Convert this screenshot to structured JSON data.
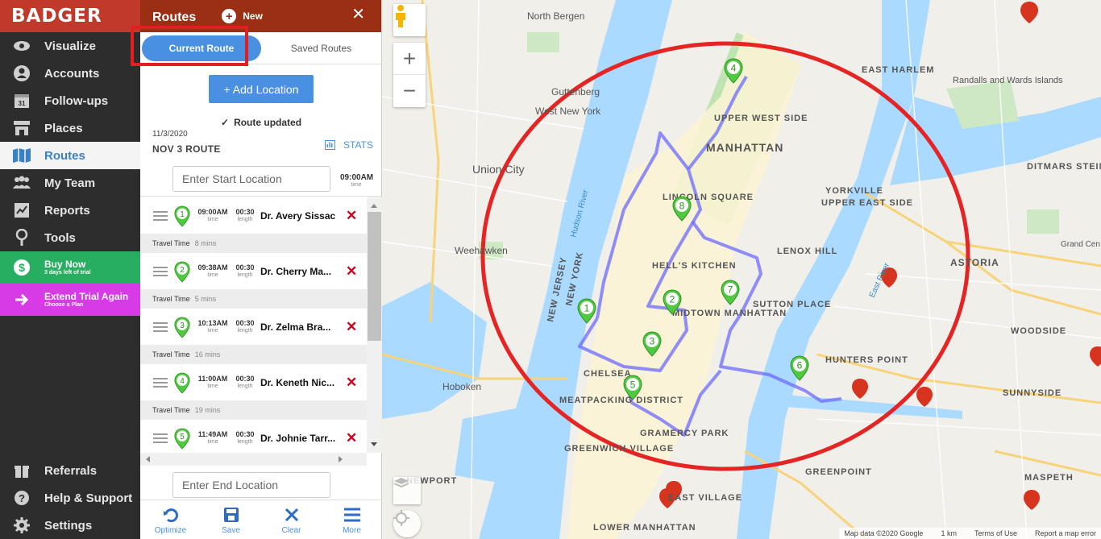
{
  "app": {
    "logo": "BADGER"
  },
  "nav": {
    "items": [
      {
        "key": "visualize",
        "label": "Visualize",
        "icon": "eye-icon"
      },
      {
        "key": "accounts",
        "label": "Accounts",
        "icon": "user-icon"
      },
      {
        "key": "followups",
        "label": "Follow-ups",
        "icon": "calendar-icon"
      },
      {
        "key": "places",
        "label": "Places",
        "icon": "store-icon"
      },
      {
        "key": "routes",
        "label": "Routes",
        "icon": "map-icon",
        "active": true
      },
      {
        "key": "myteam",
        "label": "My Team",
        "icon": "team-icon"
      },
      {
        "key": "reports",
        "label": "Reports",
        "icon": "report-icon"
      },
      {
        "key": "tools",
        "label": "Tools",
        "icon": "tools-icon"
      }
    ],
    "buy_now": {
      "label": "Buy Now",
      "sub": "3 days left of trial"
    },
    "extend": {
      "label": "Extend Trial Again",
      "sub": "Choose a Plan"
    },
    "bottom": [
      {
        "label": "Referrals",
        "icon": "gift-icon"
      },
      {
        "label": "Help & Support",
        "icon": "help-icon"
      },
      {
        "label": "Settings",
        "icon": "gear-icon"
      }
    ]
  },
  "panel": {
    "title": "Routes",
    "new_label": "New",
    "close": "✕",
    "tabs": {
      "current": "Current Route",
      "saved": "Saved Routes"
    },
    "add_location": "+ Add Location",
    "status": "Route updated",
    "status_check": "✓",
    "date": "11/3/2020",
    "route_name": "NOV 3 ROUTE",
    "stats": "STATS",
    "start_placeholder": "Enter Start Location",
    "start_time": "09:00AM",
    "time_label": "time",
    "length_label": "length",
    "travel_label": "Travel Time",
    "stops": [
      {
        "num": "1",
        "time": "09:00AM",
        "length": "00:30",
        "name": "Dr. Avery Sissac",
        "travel": "8 mins"
      },
      {
        "num": "2",
        "time": "09:38AM",
        "length": "00:30",
        "name": "Dr. Cherry Ma...",
        "travel": "5 mins"
      },
      {
        "num": "3",
        "time": "10:13AM",
        "length": "00:30",
        "name": "Dr. Zelma Bra...",
        "travel": "16 mins"
      },
      {
        "num": "4",
        "time": "11:00AM",
        "length": "00:30",
        "name": "Dr. Keneth Nic...",
        "travel": "19 mins"
      },
      {
        "num": "5",
        "time": "11:49AM",
        "length": "00:30",
        "name": "Dr. Johnie Tarr..."
      }
    ],
    "end_placeholder": "Enter End Location",
    "toolbar": [
      {
        "label": "Optimize",
        "icon": "optimize-icon"
      },
      {
        "label": "Save",
        "icon": "save-icon"
      },
      {
        "label": "Clear",
        "icon": "clear-icon"
      },
      {
        "label": "More",
        "icon": "menu-icon"
      }
    ]
  },
  "map": {
    "labels": [
      "North Bergen",
      "Guttenberg",
      "West New York",
      "Union City",
      "Weehawken",
      "Hoboken",
      "MANHATTAN",
      "UPPER WEST SIDE",
      "LINCOLN SQUARE",
      "HELL'S KITCHEN",
      "MIDTOWN MANHATTAN",
      "CHELSEA",
      "MEATPACKING DISTRICT",
      "GRAMERCY PARK",
      "GREENWICH VILLAGE",
      "EAST VILLAGE",
      "LOWER MANHATTAN",
      "NEWPORT",
      "YORKVILLE",
      "UPPER EAST SIDE",
      "LENOX HILL",
      "SUTTON PLACE",
      "EAST HARLEM",
      "Randalls and Wards Islands",
      "ASTORIA",
      "DITMARS STEINWAY",
      "WOODSIDE",
      "HUNTERS POINT",
      "SUNNYSIDE",
      "GREENPOINT",
      "MASPETH",
      "NEW JERSEY",
      "NEW YORK",
      "Hudson River",
      "East River",
      "Grand Cen"
    ],
    "markers": [
      "1",
      "2",
      "3",
      "4",
      "5",
      "6",
      "7",
      "8"
    ],
    "zoom_in": "+",
    "zoom_out": "−",
    "footer": {
      "data": "Map data ©2020 Google",
      "scale": "1 km",
      "terms": "Terms of Use",
      "report": "Report a map error"
    },
    "colors": {
      "route": "#6b6bff",
      "circle": "#e52424",
      "pin_green": "#4fc93f",
      "pin_red": "#d7341f",
      "water": "#aadaff"
    }
  }
}
